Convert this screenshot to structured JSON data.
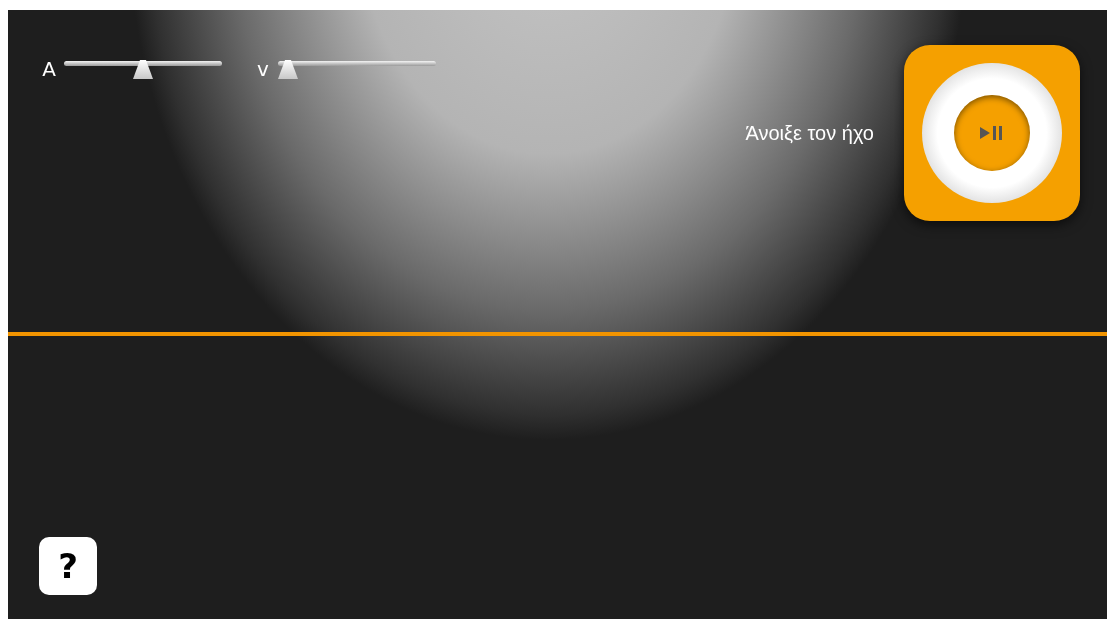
{
  "sliders": [
    {
      "label": "A",
      "level": 0.5
    },
    {
      "label": "v",
      "level": 0.0
    }
  ],
  "sound_prompt": "Άνοιξε τον ήχο",
  "help_button": "?"
}
